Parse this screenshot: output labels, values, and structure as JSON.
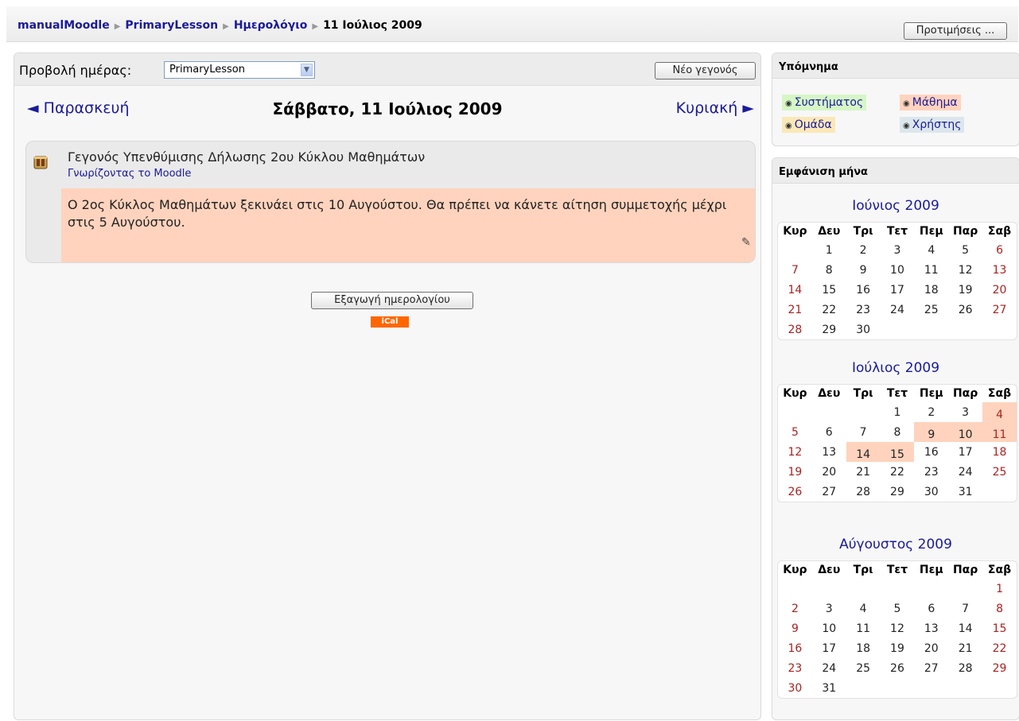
{
  "breadcrumb": {
    "items": [
      "manualMoodle",
      "PrimaryLesson",
      "Ημερολόγιο"
    ],
    "current": "11 Ιούλιος 2009",
    "separator": "▶"
  },
  "header": {
    "prefs_button": "Προτιμήσεις ..."
  },
  "view": {
    "label": "Προβολή ημέρας:",
    "course_select": "PrimaryLesson",
    "new_event_button": "Νέο γεγονός"
  },
  "nav": {
    "prev": "◄ Παρασκευή",
    "title": "Σάββατο, 11 Ιούλιος 2009",
    "next": "Κυριακή ►"
  },
  "event": {
    "title": "Γεγονός Υπενθύμισης Δήλωσης 2ου Κύκλου Μαθημάτων",
    "course": "Γνωρίζοντας το Moodle",
    "description": "Ο 2ος Κύκλος Μαθημάτων ξεκινάει στις 10 Αυγούστου. Θα πρέπει να κάνετε αίτηση συμμετοχής μέχρι στις 5 Αυγούστου."
  },
  "export": {
    "button": "Εξαγωγή ημερολογίου",
    "ical": "iCal"
  },
  "legend": {
    "title": "Υπόμνημα",
    "system": "Συστήματος",
    "course": "Μάθημα",
    "group": "Ομάδα",
    "user": "Χρήστης"
  },
  "months_block": {
    "title": "Εμφάνιση μήνα",
    "weekdays": [
      "Κυρ",
      "Δευ",
      "Τρι",
      "Τετ",
      "Πεμ",
      "Παρ",
      "Σαβ"
    ],
    "months": [
      {
        "title": "Ιούνιος 2009",
        "weeks": [
          [
            "",
            "1",
            "2",
            "3",
            "4",
            "5",
            "6"
          ],
          [
            "7",
            "8",
            "9",
            "10",
            "11",
            "12",
            "13"
          ],
          [
            "14",
            "15",
            "16",
            "17",
            "18",
            "19",
            "20"
          ],
          [
            "21",
            "22",
            "23",
            "24",
            "25",
            "26",
            "27"
          ],
          [
            "28",
            "29",
            "30",
            "",
            "",
            "",
            ""
          ]
        ],
        "event_days": []
      },
      {
        "title": "Ιούλιος 2009",
        "weeks": [
          [
            "",
            "",
            "",
            "1",
            "2",
            "3",
            "4"
          ],
          [
            "5",
            "6",
            "7",
            "8",
            "9",
            "10",
            "11"
          ],
          [
            "12",
            "13",
            "14",
            "15",
            "16",
            "17",
            "18"
          ],
          [
            "19",
            "20",
            "21",
            "22",
            "23",
            "24",
            "25"
          ],
          [
            "26",
            "27",
            "28",
            "29",
            "30",
            "31",
            ""
          ]
        ],
        "event_days": [
          "4",
          "9",
          "10",
          "11",
          "14",
          "15"
        ]
      },
      {
        "title": "Αύγουστος 2009",
        "weeks": [
          [
            "",
            "",
            "",
            "",
            "",
            "",
            "1"
          ],
          [
            "2",
            "3",
            "4",
            "5",
            "6",
            "7",
            "8"
          ],
          [
            "9",
            "10",
            "11",
            "12",
            "13",
            "14",
            "15"
          ],
          [
            "16",
            "17",
            "18",
            "19",
            "20",
            "21",
            "22"
          ],
          [
            "23",
            "24",
            "25",
            "26",
            "27",
            "28",
            "29"
          ],
          [
            "30",
            "31",
            "",
            "",
            "",
            "",
            ""
          ]
        ],
        "event_days": []
      }
    ]
  }
}
